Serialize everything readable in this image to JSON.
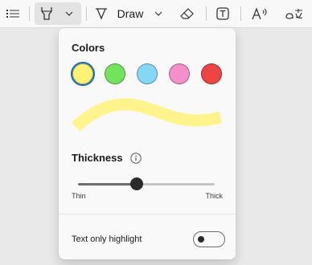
{
  "toolbar": {
    "draw_label": "Draw"
  },
  "panel": {
    "colors_heading": "Colors",
    "swatches": [
      {
        "name": "yellow",
        "color": "#fff275",
        "selected": true
      },
      {
        "name": "green",
        "color": "#72e35c"
      },
      {
        "name": "light-blue",
        "color": "#86d6f7"
      },
      {
        "name": "pink",
        "color": "#f48fc9"
      },
      {
        "name": "red",
        "color": "#ef4444"
      }
    ],
    "thickness_heading": "Thickness",
    "thickness_value": 0.43,
    "min_label": "Thin",
    "max_label": "Thick",
    "toggle_label": "Text only highlight",
    "toggle_on": false
  },
  "colors": {
    "accent": "#0f6cbd",
    "highlight_preview": "#fff38c"
  }
}
